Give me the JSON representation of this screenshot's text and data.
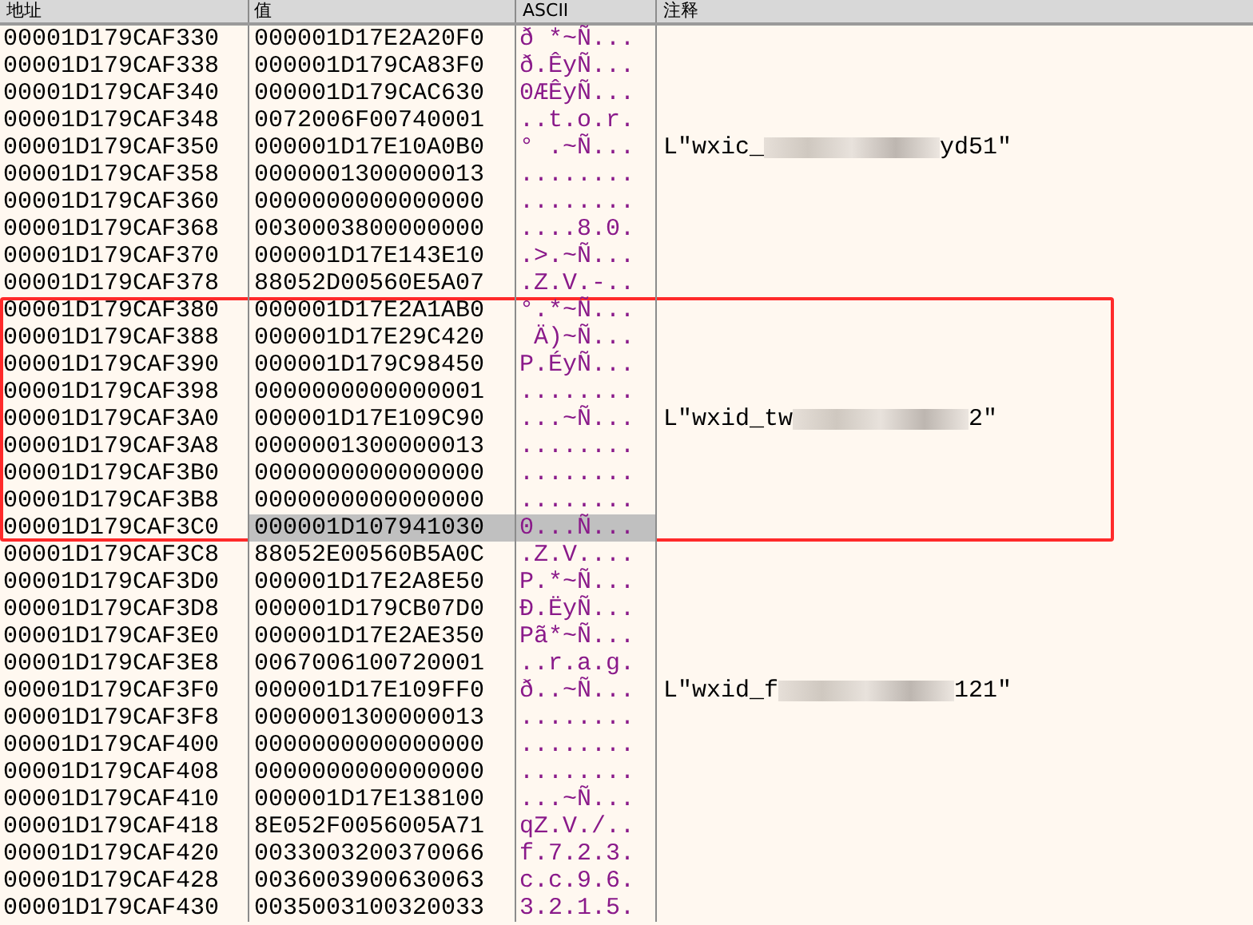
{
  "columns": [
    "地址",
    "值",
    "ASCII",
    "注释"
  ],
  "rows_above": [
    {
      "address": "00001D179CAF330",
      "value": "000001D17E2A20F0",
      "ascii": "ð *~Ñ...",
      "selected": false
    },
    {
      "address": "00001D179CAF338",
      "value": "000001D179CA83F0",
      "ascii": "ð.ÊyÑ...",
      "selected": false
    },
    {
      "address": "00001D179CAF340",
      "value": "000001D179CAC630",
      "ascii": "0ÆÊyÑ...",
      "selected": false
    },
    {
      "address": "00001D179CAF348",
      "value": "0072006F00740001",
      "ascii": "..t.o.r.",
      "selected": false
    },
    {
      "address": "00001D179CAF350",
      "value": "000001D17E10A0B0",
      "ascii": "° .~Ñ...",
      "selected": false,
      "comment": {
        "prefix": "L\"wxic_",
        "suffix": "yd51\""
      }
    },
    {
      "address": "00001D179CAF358",
      "value": "0000001300000013",
      "ascii": "........",
      "selected": false
    },
    {
      "address": "00001D179CAF360",
      "value": "0000000000000000",
      "ascii": "........",
      "selected": false
    },
    {
      "address": "00001D179CAF368",
      "value": "0030003800000000",
      "ascii": "....8.0.",
      "selected": false
    },
    {
      "address": "00001D179CAF370",
      "value": "000001D17E143E10",
      "ascii": ".>.~Ñ...",
      "selected": false
    },
    {
      "address": "00001D179CAF378",
      "value": "88052D00560E5A07",
      "ascii": ".Z.V.-..",
      "selected": false
    }
  ],
  "annotation_box": {
    "rows": [
      {
        "address": "00001D179CAF380",
        "value": "000001D17E2A1AB0",
        "ascii": "°.*~Ñ...",
        "selected": false
      },
      {
        "address": "00001D179CAF388",
        "value": "000001D17E29C420",
        "ascii": " Ä)~Ñ...",
        "selected": false
      },
      {
        "address": "00001D179CAF390",
        "value": "000001D179C98450",
        "ascii": "P.ÉyÑ...",
        "selected": false
      },
      {
        "address": "00001D179CAF398",
        "value": "0000000000000001",
        "ascii": "........",
        "selected": false
      },
      {
        "address": "00001D179CAF3A0",
        "value": "000001D17E109C90",
        "ascii": "...~Ñ...",
        "selected": false,
        "comment": {
          "prefix": "L\"wxid_tw",
          "suffix": "2\""
        }
      },
      {
        "address": "00001D179CAF3A8",
        "value": "0000001300000013",
        "ascii": "........",
        "selected": false
      },
      {
        "address": "00001D179CAF3B0",
        "value": "0000000000000000",
        "ascii": "........",
        "selected": false
      },
      {
        "address": "00001D179CAF3B8",
        "value": "0000000000000000",
        "ascii": "........",
        "selected": false
      },
      {
        "address": "00001D179CAF3C0",
        "value": "000001D107941030",
        "ascii": "0...Ñ...",
        "selected": true
      }
    ]
  },
  "rows_below": [
    {
      "address": "00001D179CAF3C8",
      "value": "88052E00560B5A0C",
      "ascii": ".Z.V....",
      "selected": false
    },
    {
      "address": "00001D179CAF3D0",
      "value": "000001D17E2A8E50",
      "ascii": "P.*~Ñ...",
      "selected": false
    },
    {
      "address": "00001D179CAF3D8",
      "value": "000001D179CB07D0",
      "ascii": "Ð.ËyÑ...",
      "selected": false
    },
    {
      "address": "00001D179CAF3E0",
      "value": "000001D17E2AE350",
      "ascii": "Pã*~Ñ...",
      "selected": false
    },
    {
      "address": "00001D179CAF3E8",
      "value": "0067006100720001",
      "ascii": "..r.a.g.",
      "selected": false
    },
    {
      "address": "00001D179CAF3F0",
      "value": "000001D17E109FF0",
      "ascii": "ð..~Ñ...",
      "selected": false,
      "comment": {
        "prefix": "L\"wxid_f",
        "suffix": "121\""
      }
    },
    {
      "address": "00001D179CAF3F8",
      "value": "0000001300000013",
      "ascii": "........",
      "selected": false
    },
    {
      "address": "00001D179CAF400",
      "value": "0000000000000000",
      "ascii": "........",
      "selected": false
    },
    {
      "address": "00001D179CAF408",
      "value": "0000000000000000",
      "ascii": "........",
      "selected": false
    },
    {
      "address": "00001D179CAF410",
      "value": "000001D17E138100",
      "ascii": "...~Ñ...",
      "selected": false
    },
    {
      "address": "00001D179CAF418",
      "value": "8E052F0056005A71",
      "ascii": "qZ.V./..",
      "selected": false
    },
    {
      "address": "00001D179CAF420",
      "value": "0033003200370066",
      "ascii": "f.7.2.3.",
      "selected": false
    },
    {
      "address": "00001D179CAF428",
      "value": "0036003900630063",
      "ascii": "c.c.9.6.",
      "selected": false
    },
    {
      "address": "00001D179CAF430",
      "value": "0035003100320033",
      "ascii": "3.2.1.5.",
      "selected": false
    }
  ]
}
